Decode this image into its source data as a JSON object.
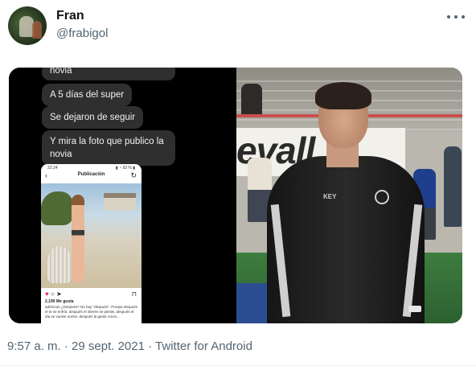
{
  "author": {
    "name": "Fran",
    "handle": "@frabigol"
  },
  "media": {
    "chat": {
      "messages": [
        "novia",
        "A 5 días del super",
        "Se dejaron de seguir",
        "Y mira la foto que publico la novia"
      ]
    },
    "phone": {
      "status_time": "22:24",
      "status_right": "▮ ◔ 93 % ▮",
      "screen_title": "Publicación",
      "likes": "2.190 Me gusta",
      "caption": "adrimoos ¿Después? No hay \"después\". Porque después el te se enfría, después el interés se pierde, después el día se vuelve noche, después la gente crece..."
    },
    "photo": {
      "banner_text": "evall",
      "jacket_brand": "KEY"
    }
  },
  "meta": {
    "time": "9:57 a. m.",
    "separator": "·",
    "date": "29 sept. 2021",
    "source": "Twitter for Android"
  }
}
